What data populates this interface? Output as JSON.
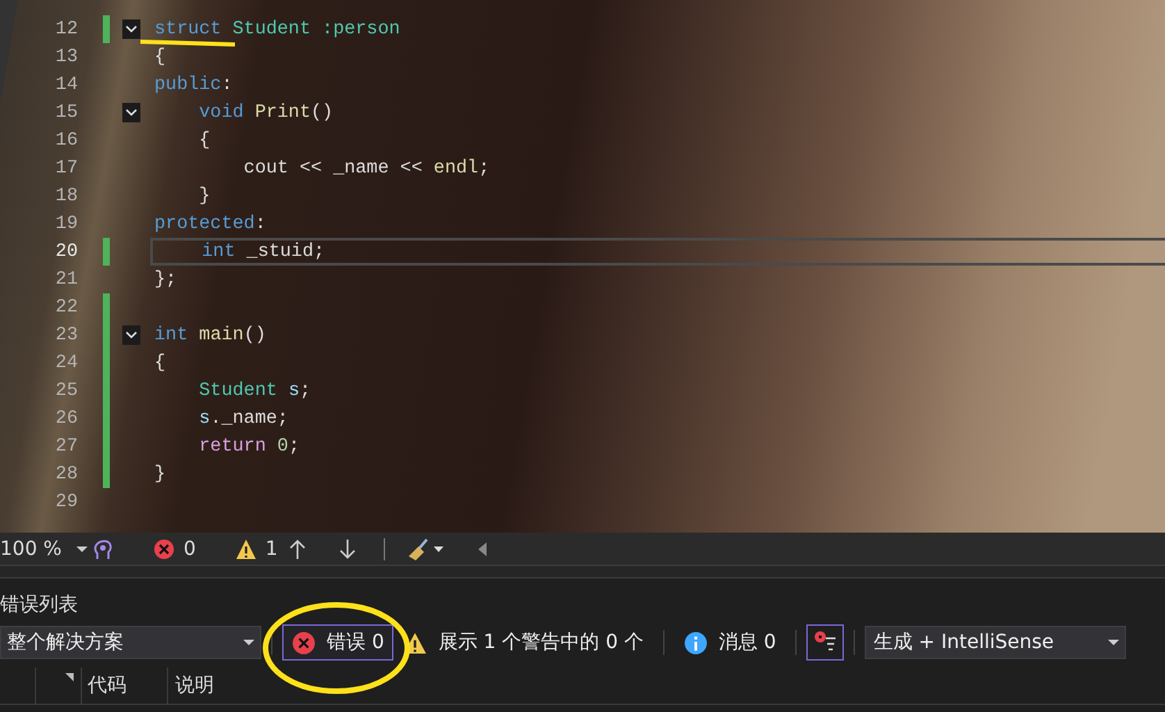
{
  "editor": {
    "lines": [
      {
        "number": "12",
        "fold": true,
        "changed": true,
        "current": false,
        "tokens": [
          {
            "kind": "keyword",
            "text": "struct "
          },
          {
            "kind": "type",
            "text": "Student :person"
          }
        ]
      },
      {
        "number": "13",
        "fold": false,
        "changed": false,
        "current": false,
        "tokens": [
          {
            "kind": "plain",
            "text": "{"
          }
        ]
      },
      {
        "number": "14",
        "fold": false,
        "changed": false,
        "current": false,
        "tokens": [
          {
            "kind": "keyword",
            "text": "public"
          },
          {
            "kind": "plain",
            "text": ":"
          }
        ]
      },
      {
        "number": "15",
        "fold": true,
        "changed": false,
        "current": false,
        "tokens": [
          {
            "kind": "keyword",
            "text": "    void "
          },
          {
            "kind": "func",
            "text": "Print"
          },
          {
            "kind": "plain",
            "text": "()"
          }
        ]
      },
      {
        "number": "16",
        "fold": false,
        "changed": false,
        "current": false,
        "tokens": [
          {
            "kind": "plain",
            "text": "    {"
          }
        ]
      },
      {
        "number": "17",
        "fold": false,
        "changed": false,
        "current": false,
        "tokens": [
          {
            "kind": "plain",
            "text": "        cout << _name << "
          },
          {
            "kind": "func",
            "text": "endl"
          },
          {
            "kind": "plain",
            "text": ";"
          }
        ]
      },
      {
        "number": "18",
        "fold": false,
        "changed": false,
        "current": false,
        "tokens": [
          {
            "kind": "plain",
            "text": "    }"
          }
        ]
      },
      {
        "number": "19",
        "fold": false,
        "changed": false,
        "current": false,
        "tokens": [
          {
            "kind": "keyword",
            "text": "protected"
          },
          {
            "kind": "plain",
            "text": ":"
          }
        ]
      },
      {
        "number": "20",
        "fold": false,
        "changed": true,
        "current": true,
        "tokens": [
          {
            "kind": "keyword",
            "text": "    int"
          },
          {
            "kind": "plain",
            "text": " _stuid;"
          }
        ]
      },
      {
        "number": "21",
        "fold": false,
        "changed": false,
        "current": false,
        "tokens": [
          {
            "kind": "plain",
            "text": "};"
          }
        ]
      },
      {
        "number": "22",
        "fold": false,
        "changed": true,
        "current": false
      },
      {
        "number": "23",
        "fold": true,
        "changed": true,
        "current": false,
        "tokens": [
          {
            "kind": "keyword",
            "text": "int "
          },
          {
            "kind": "func",
            "text": "main"
          },
          {
            "kind": "plain",
            "text": "()"
          }
        ]
      },
      {
        "number": "24",
        "fold": false,
        "changed": true,
        "current": false,
        "tokens": [
          {
            "kind": "plain",
            "text": "{"
          }
        ]
      },
      {
        "number": "25",
        "fold": false,
        "changed": true,
        "current": false,
        "tokens": [
          {
            "kind": "type",
            "text": "    Student "
          },
          {
            "kind": "var",
            "text": "s"
          },
          {
            "kind": "plain",
            "text": ";"
          }
        ]
      },
      {
        "number": "26",
        "fold": false,
        "changed": true,
        "current": false,
        "tokens": [
          {
            "kind": "var",
            "text": "    s"
          },
          {
            "kind": "plain",
            "text": "._name;"
          }
        ]
      },
      {
        "number": "27",
        "fold": false,
        "changed": true,
        "current": false,
        "tokens": [
          {
            "kind": "control",
            "text": "    return "
          },
          {
            "kind": "number",
            "text": "0"
          },
          {
            "kind": "plain",
            "text": ";"
          }
        ]
      },
      {
        "number": "28",
        "fold": false,
        "changed": true,
        "current": false,
        "tokens": [
          {
            "kind": "plain",
            "text": "}"
          }
        ]
      },
      {
        "number": "29",
        "fold": false,
        "changed": false,
        "current": false
      }
    ]
  },
  "toolbar": {
    "zoom": "100 %",
    "errors": "0",
    "warnings": "1"
  },
  "error_list": {
    "title": "错误列表",
    "scope": "整个解决方案",
    "errors_filter": {
      "label": "错误 0",
      "selected": true
    },
    "warnings_filter": {
      "label": "展示 1 个警告中的 0 个",
      "selected": false
    },
    "messages_filter": {
      "label": "消息 0",
      "selected": false
    },
    "build_filter": {
      "selected": true
    },
    "source": "生成 + IntelliSense",
    "columns": [
      "代码",
      "说明"
    ]
  }
}
